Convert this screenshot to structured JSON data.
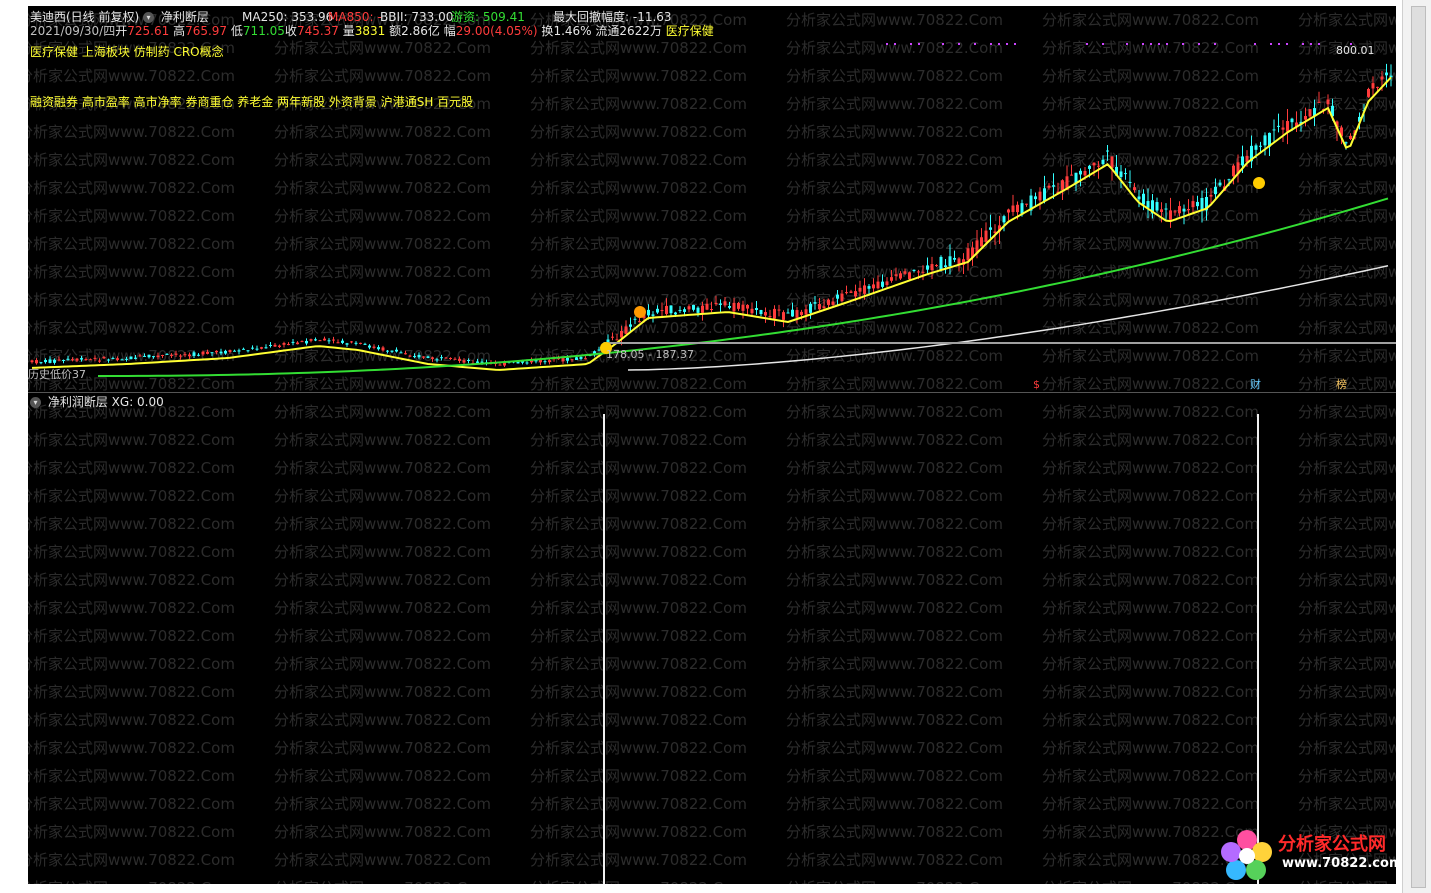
{
  "main_panel": {
    "stock_name": "美迪西(日线 前复权)",
    "indicator_name": "净利断层",
    "ma250_label": "MA250: 353.96",
    "ma850_label": "MA850: -",
    "bbii_label": "BBII: 733.00",
    "youzi_label": "游资: 509.41",
    "max_drawdown": "最大回撤幅度: -11.63",
    "quote": {
      "date": "2021/09/30/四",
      "open_label": "开",
      "open": "725.61",
      "high_label": "高",
      "high": "765.97",
      "low_label": "低",
      "low": "711.05",
      "close_label": "收",
      "close": "745.37",
      "vol_label": "量",
      "vol": "3831",
      "amount_label": "额",
      "amount": "2.86亿",
      "change_label": "幅",
      "change": "29.00(4.05%)",
      "turnover_label": "换",
      "turnover": "1.46%",
      "float_label": "流通",
      "float": "2622万",
      "sector": "医疗保健"
    },
    "concepts_line1": "医疗保健 上海板块 仿制药 CRO概念",
    "concepts_line2": "融资融券 高市盈率 高市净率 券商重仓 养老金 两年新股 外资背景 沪港通SH 百元股",
    "price_high_label": "800.01",
    "support_label": "178.05 - 187.37",
    "low_label": "历史低价37",
    "markers": [
      "$",
      "财",
      "榜"
    ]
  },
  "sub_panel": {
    "title": "净利润断层",
    "value_label": "XG: 0.00"
  },
  "watermark": "分析家公式网www.70822.Com",
  "logo": {
    "name": "分析家公式网",
    "url": "www.70822.com"
  },
  "colors": {
    "up": "#ff3c3c",
    "down": "#33ffff",
    "ma_short": "#ffff33",
    "ma_mid": "#33dd33",
    "ma_long": "#e6e6e6"
  }
}
